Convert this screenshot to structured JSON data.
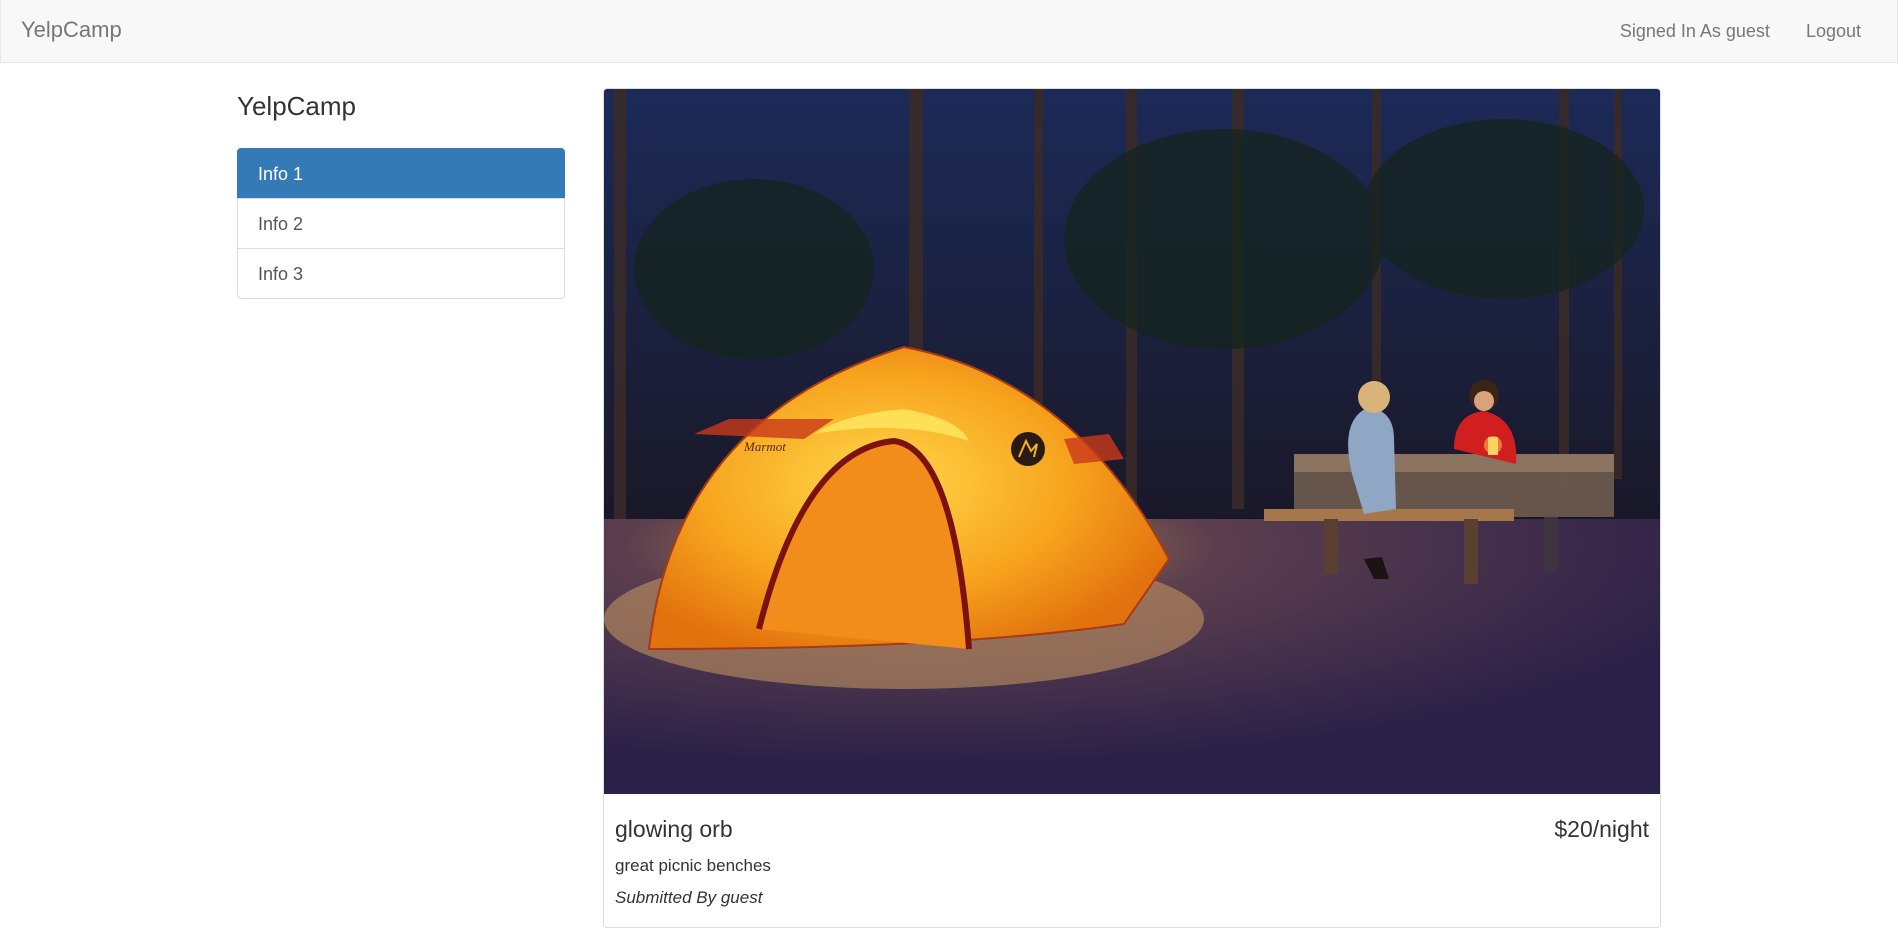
{
  "navbar": {
    "brand": "YelpCamp",
    "signed_in": "Signed In As guest",
    "logout": "Logout"
  },
  "sidebar": {
    "title": "YelpCamp",
    "items": [
      {
        "label": "Info 1",
        "active": true
      },
      {
        "label": "Info 2",
        "active": false
      },
      {
        "label": "Info 3",
        "active": false
      }
    ]
  },
  "campground": {
    "name": "glowing orb",
    "price": "$20/night",
    "description": "great picnic benches",
    "submitted_by": "Submitted By guest"
  },
  "colors": {
    "navbar_bg": "#f8f8f8",
    "active_item": "#337ab7",
    "tent": "#f5a623"
  }
}
